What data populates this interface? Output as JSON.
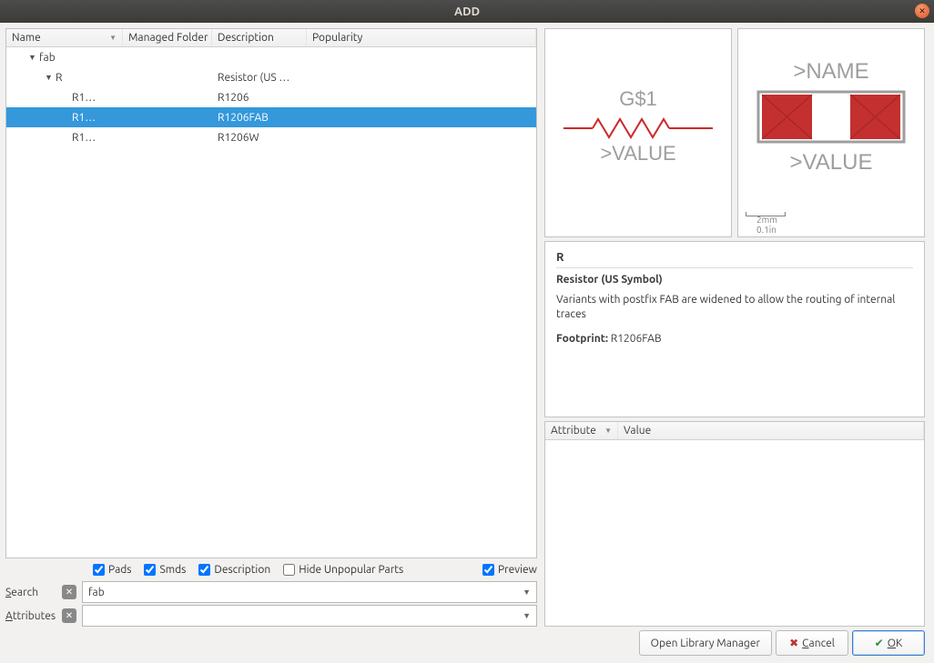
{
  "title": "ADD",
  "columns": {
    "name": "Name",
    "managed": "Managed Folder",
    "description": "Description",
    "popularity": "Popularity"
  },
  "tree": [
    {
      "indent": 1,
      "name": "fab",
      "desc": "",
      "toggle": "▼",
      "selected": false
    },
    {
      "indent": 2,
      "name": "R",
      "desc": "Resistor (US …",
      "toggle": "▼",
      "selected": false
    },
    {
      "indent": 3,
      "name": "R1…",
      "desc": "R1206",
      "toggle": "",
      "selected": false
    },
    {
      "indent": 3,
      "name": "R1…",
      "desc": "R1206FAB",
      "toggle": "",
      "selected": true
    },
    {
      "indent": 3,
      "name": "R1…",
      "desc": "R1206W",
      "toggle": "",
      "selected": false
    }
  ],
  "filters": {
    "pads": "Pads",
    "smds": "Smds",
    "description": "Description",
    "hide_unpopular": "Hide Unpopular Parts",
    "preview": "Preview"
  },
  "search": {
    "label": "Search",
    "value": "fab"
  },
  "attributes_label": "Attributes",
  "attributes_value": "",
  "schematic": {
    "gname": "G$1",
    "valuetag": ">VALUE"
  },
  "footprint": {
    "nametag": ">NAME",
    "valuetag": ">VALUE",
    "scale_mm": "2mm",
    "scale_in": "0.1in"
  },
  "detail": {
    "heading": "R",
    "title": "Resistor (US Symbol)",
    "body": "Variants with postfix FAB are widened to allow the routing of internal traces",
    "footprint_label": "Footprint:",
    "footprint_value": "R1206FAB"
  },
  "attr_cols": {
    "attribute": "Attribute",
    "value": "Value"
  },
  "buttons": {
    "libmgr": "Open Library Manager",
    "cancel": "Cancel",
    "ok": "OK"
  }
}
